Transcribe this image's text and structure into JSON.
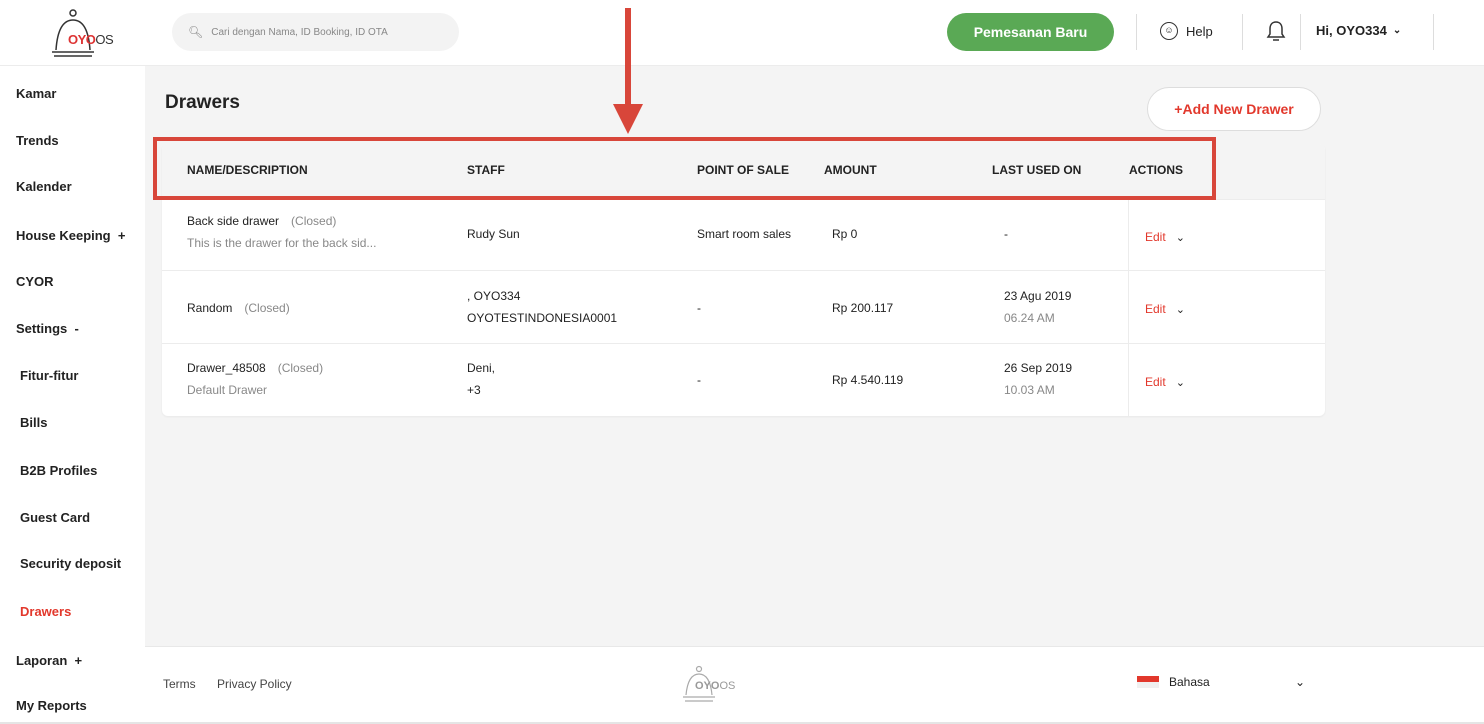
{
  "header": {
    "logo_text": "OYO",
    "logo_suffix": "OS",
    "search_placeholder": "Cari dengan Nama, ID Booking, ID OTA",
    "new_booking_label": "Pemesanan Baru",
    "help_label": "Help",
    "user_label": "Hi, OYO334"
  },
  "sidebar": {
    "items": [
      {
        "label": "Kamar"
      },
      {
        "label": "Trends"
      },
      {
        "label": "Kalender"
      },
      {
        "label": "House Keeping  +"
      },
      {
        "label": "CYOR"
      },
      {
        "label": "Settings  -"
      },
      {
        "label": "Fitur-fitur"
      },
      {
        "label": "Bills"
      },
      {
        "label": "B2B Profiles"
      },
      {
        "label": "Guest Card"
      },
      {
        "label": "Security deposit"
      },
      {
        "label": "Drawers"
      },
      {
        "label": "Laporan  +"
      },
      {
        "label": "My Reports"
      }
    ],
    "active": "Drawers"
  },
  "main": {
    "title": "Drawers",
    "add_button_label": "+Add New Drawer",
    "table": {
      "columns": [
        "NAME/DESCRIPTION",
        "STAFF",
        "POINT OF SALE",
        "AMOUNT",
        "LAST USED ON",
        "ACTIONS"
      ],
      "rows": [
        {
          "name": "Back side drawer",
          "status": "(Closed)",
          "description": "This is the drawer for the back sid...",
          "staff_line1": "Rudy Sun",
          "staff_line2": "",
          "pos": "Smart room sales",
          "amount": "Rp 0",
          "last_date": "-",
          "last_time": "",
          "action": "Edit"
        },
        {
          "name": "Random",
          "status": "(Closed)",
          "description": "",
          "staff_line1": ", OYO334",
          "staff_line2": "OYOTESTINDONESIA0001",
          "pos": "-",
          "amount": "Rp 200.117",
          "last_date": "23 Agu 2019",
          "last_time": "06.24 AM",
          "action": "Edit"
        },
        {
          "name": "Drawer_48508",
          "status": "(Closed)",
          "description": "Default Drawer",
          "staff_line1": "Deni,",
          "staff_line2": "+3",
          "pos": "-",
          "amount": "Rp 4.540.119",
          "last_date": "26 Sep 2019",
          "last_time": "10.03 AM",
          "action": "Edit"
        }
      ]
    }
  },
  "footer": {
    "terms_label": "Terms",
    "privacy_label": "Privacy Policy",
    "language_label": "Bahasa"
  },
  "colors": {
    "accent": "#e2382c",
    "primary_green": "#5aa955",
    "annotation": "#d8463a"
  }
}
